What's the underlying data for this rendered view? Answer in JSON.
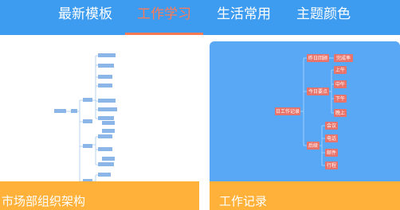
{
  "tabs": [
    {
      "label": "最新模板",
      "active": false
    },
    {
      "label": "工作学习",
      "active": true
    },
    {
      "label": "生活常用",
      "active": false
    },
    {
      "label": "主题颜色",
      "active": false
    }
  ],
  "cards": [
    {
      "label": "市场部组织架构"
    },
    {
      "label": "工作记录"
    }
  ],
  "work_log_map": {
    "root": "日工作记录",
    "branch_1": "昨日回顾",
    "branch_1_child": "完成率",
    "branch_2": "今日要点",
    "branch_2_children": [
      "上午",
      "中午",
      "下午",
      "晚上"
    ],
    "branch_3": "后续",
    "branch_3_children": [
      "会议",
      "电话",
      "邮件",
      "行程"
    ]
  },
  "colors": {
    "tabbar": "#3d9cf0",
    "active_tab": "#ff7a55",
    "card_label": "#ffb13a",
    "node_red": "#e8736a",
    "node_blue": "#8cb6e8"
  }
}
